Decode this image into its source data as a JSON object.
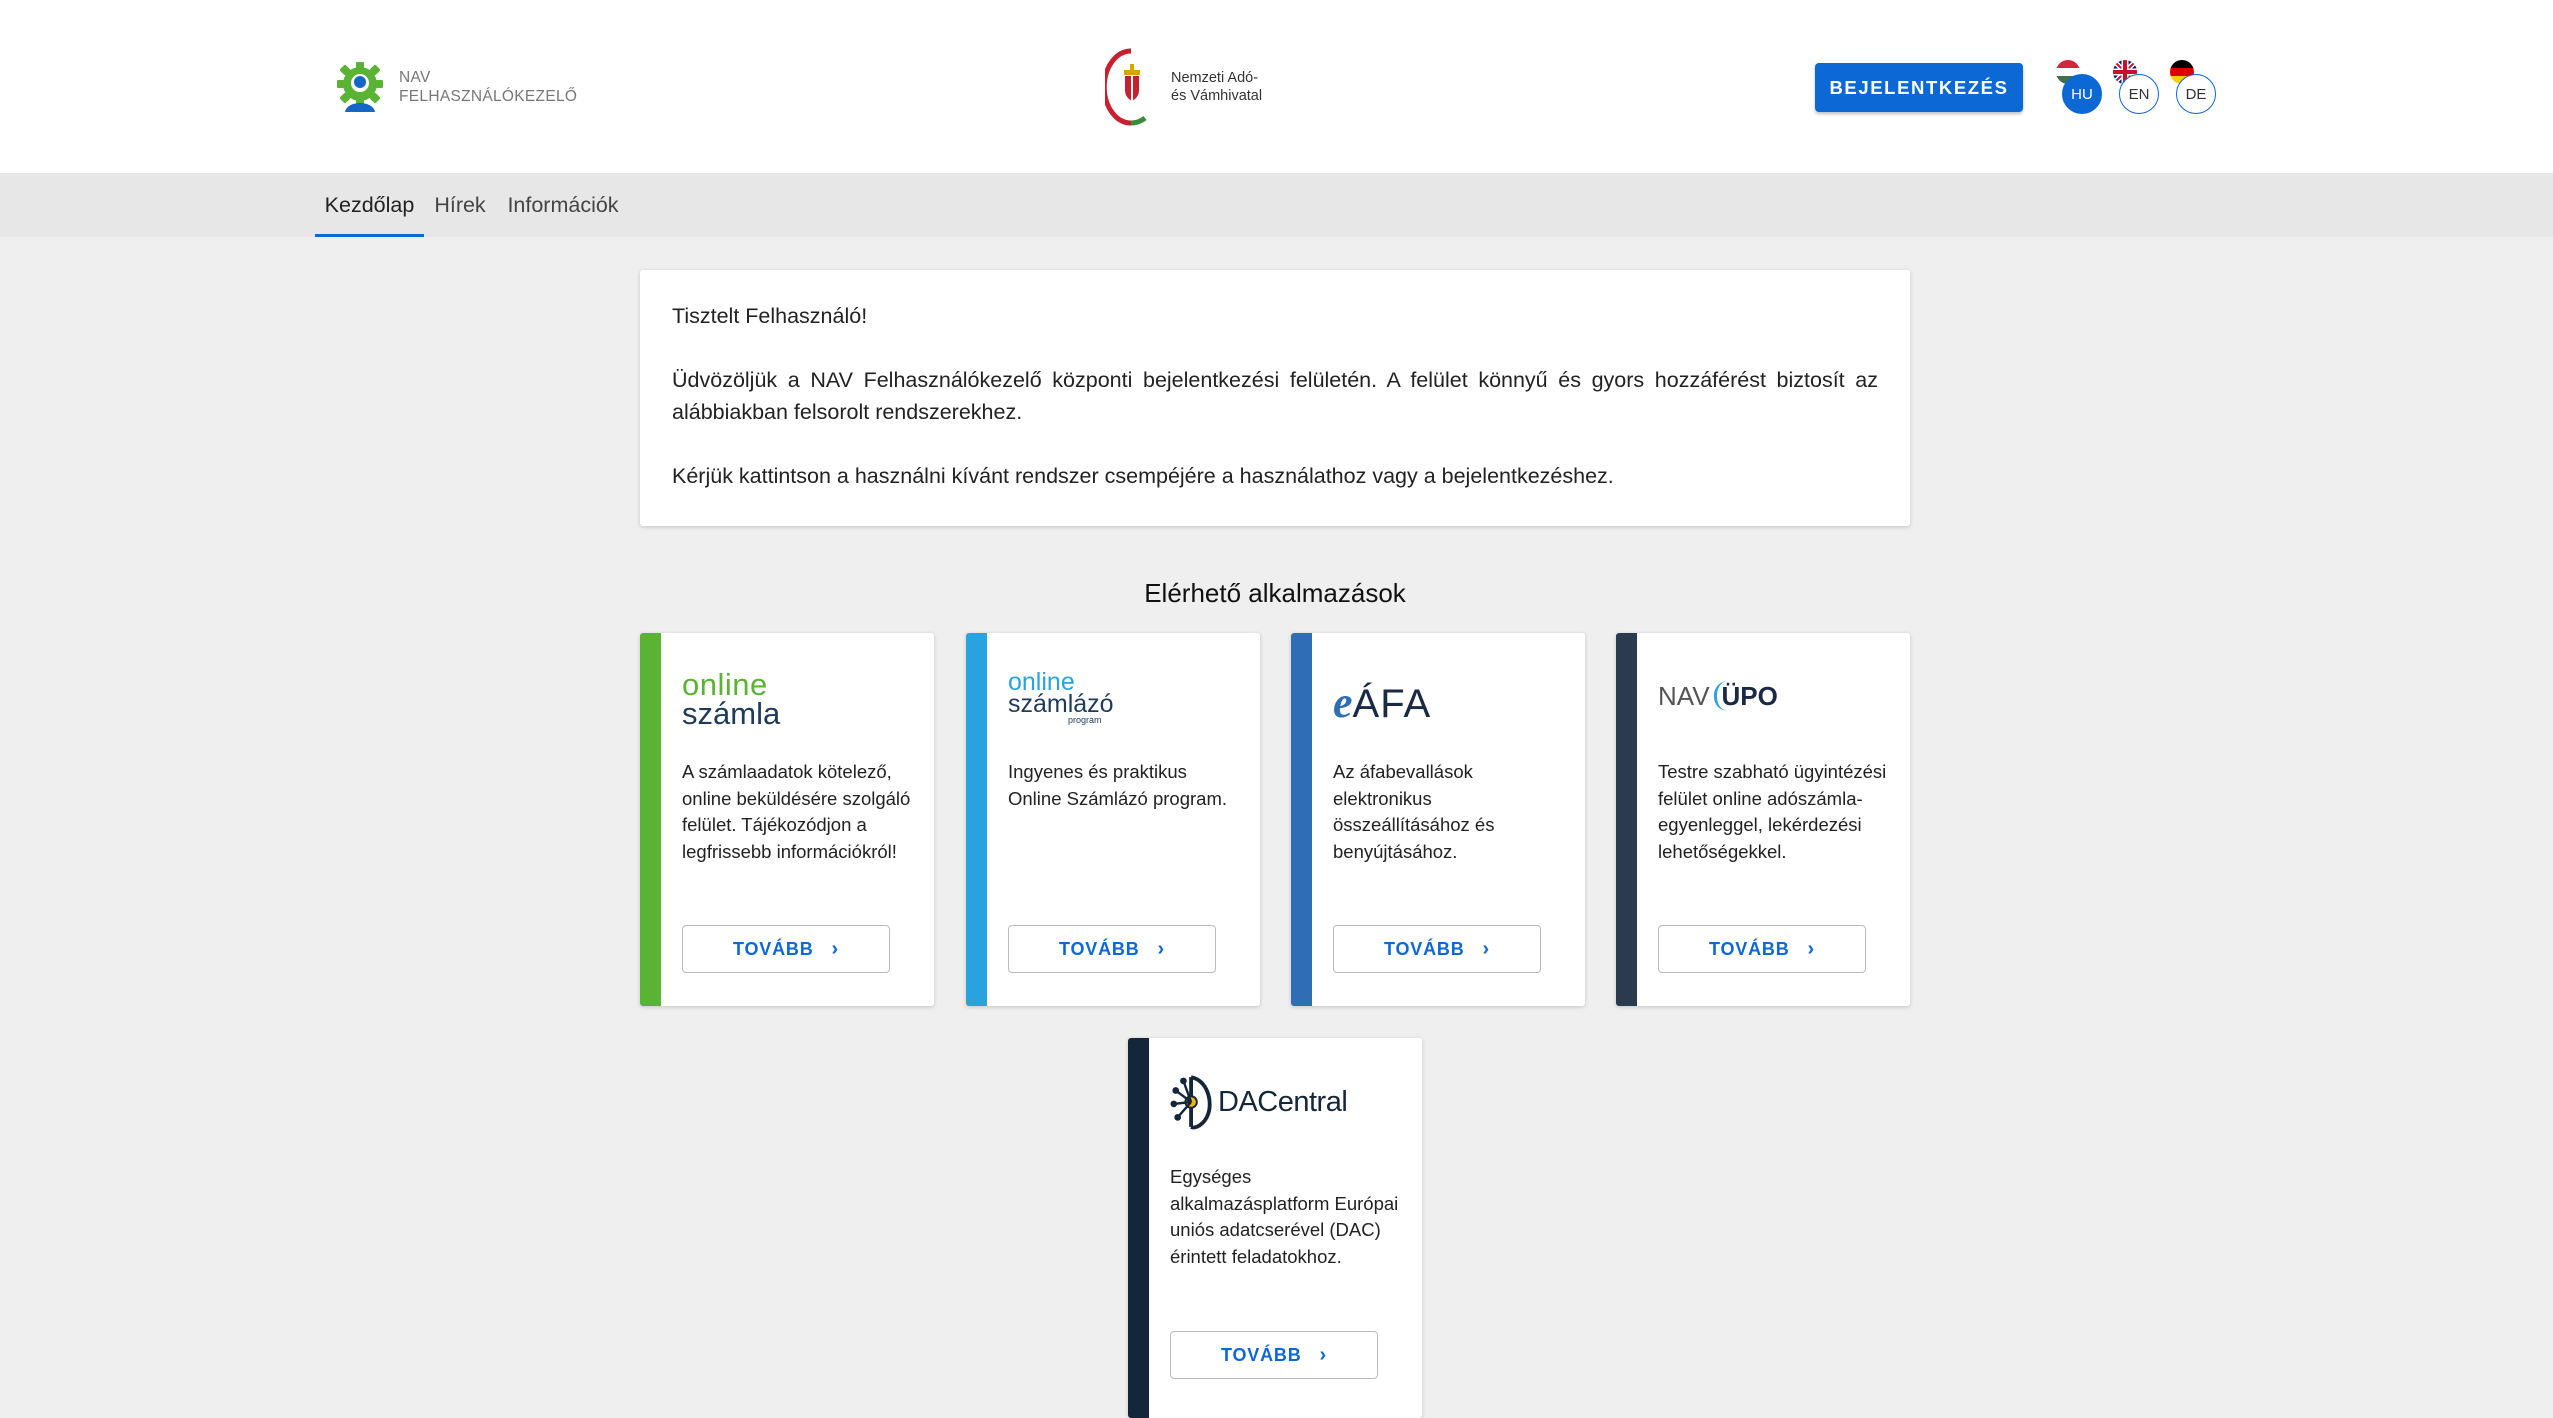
{
  "header": {
    "brand_line1": "NAV",
    "brand_line2": "FELHASZNÁLÓKEZELŐ",
    "org_line1": "Nemzeti Adó-",
    "org_line2": "és Vámhivatal",
    "login_label": "BEJELENTKEZÉS",
    "languages": [
      {
        "code": "HU",
        "active": true
      },
      {
        "code": "EN",
        "active": false
      },
      {
        "code": "DE",
        "active": false
      }
    ]
  },
  "tabs": [
    {
      "label": "Kezdőlap",
      "active": true
    },
    {
      "label": "Hírek",
      "active": false
    },
    {
      "label": "Információk",
      "active": false
    }
  ],
  "welcome": {
    "greeting": "Tisztelt Felhasználó!",
    "paragraph1": "Üdvözöljük a NAV Felhasználókezelő központi bejelentkezési felületén. A felület könnyű és gyors hozzáférést biztosít az alábbiakban felsorolt rendszerekhez.",
    "paragraph2": "Kérjük kattintson a használni kívánt rendszer csempéjére a használathoz vagy a bejelentkezéshez."
  },
  "apps_title": "Elérhető alkalmazások",
  "apps": [
    {
      "logo_line1": "online",
      "logo_line2": "számla",
      "description": "A számlaadatok kötelező, online beküldésére szolgáló felület. Tájékozódjon a legfrissebb információkról!",
      "button": "TOVÁBB",
      "accent": "#5bb334"
    },
    {
      "logo_line1": "online",
      "logo_line2": "számlázó",
      "logo_line3": "program",
      "description": "Ingyenes és praktikus Online Számlázó program.",
      "button": "TOVÁBB",
      "accent": "#29a3e0"
    },
    {
      "logo_prefix": "e",
      "logo_main": "ÁFA",
      "description": "Az áfabevallások elektronikus összeállításához és benyújtásához.",
      "button": "TOVÁBB",
      "accent": "#2f6db5"
    },
    {
      "logo_prefix": "NAV",
      "logo_main": "ÜPO",
      "description": "Testre szabható ügyintézési felület online adószámla-egyenleggel, lekérdezési lehetőségekkel.",
      "button": "TOVÁBB",
      "accent": "#2c3a4f"
    },
    {
      "logo_main": "DACentral",
      "description": "Egységes alkalmazásplatform Európai uniós adatcserével (DAC) érintett feladatokhoz.",
      "button": "TOVÁBB",
      "accent": "#15263a"
    }
  ],
  "colors": {
    "primary": "#0b68d4",
    "page_bg": "#efefef",
    "tabbar_bg": "#e7e7e7"
  },
  "icons": [
    "user-gear-icon",
    "nav-crest-icon",
    "hungary-flag-icon",
    "uk-flag-icon",
    "germany-flag-icon",
    "chevron-right-icon",
    "dacentral-network-icon"
  ]
}
